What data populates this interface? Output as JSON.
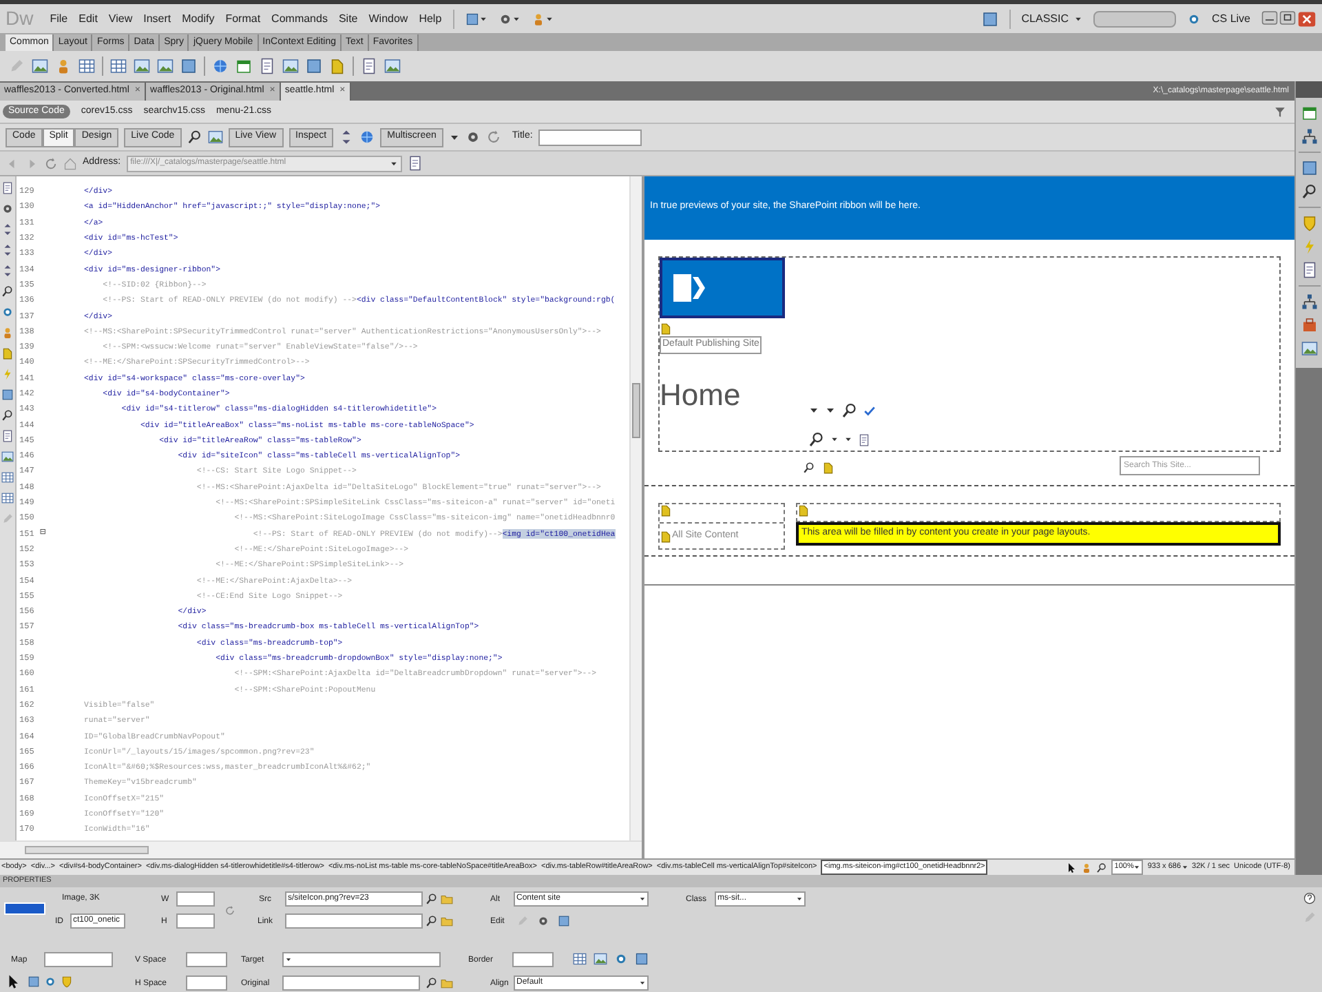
{
  "menu_bar": {
    "logo": "Dw",
    "items": [
      "File",
      "Edit",
      "View",
      "Insert",
      "Modify",
      "Format",
      "Commands",
      "Site",
      "Window",
      "Help"
    ],
    "workspace": "CLASSIC",
    "cs_live": "CS Live"
  },
  "insert_tabs": [
    {
      "label": "Common",
      "selected": true
    },
    {
      "label": "Layout",
      "selected": false
    },
    {
      "label": "Forms",
      "selected": false
    },
    {
      "label": "Data",
      "selected": false
    },
    {
      "label": "Spry",
      "selected": false
    },
    {
      "label": "jQuery Mobile",
      "selected": false
    },
    {
      "label": "InContext Editing",
      "selected": false
    },
    {
      "label": "Text",
      "selected": false
    },
    {
      "label": "Favorites",
      "selected": false
    }
  ],
  "document_tabs": [
    {
      "label": "waffles2013 - Converted.html",
      "close": "×",
      "selected": false
    },
    {
      "label": "waffles2013 - Original.html",
      "close": "×",
      "selected": false
    },
    {
      "label": "seattle.html",
      "close": "×",
      "selected": true
    }
  ],
  "document_path": "X:\\_catalogs\\masterpage\\seattle.html",
  "related_files": [
    {
      "label": "Source Code",
      "selected": true
    },
    {
      "label": "corev15.css",
      "selected": false
    },
    {
      "label": "searchv15.css",
      "selected": false
    },
    {
      "label": "menu-21.css",
      "selected": false
    }
  ],
  "document_toolbar": {
    "views": [
      {
        "label": "Code",
        "selected": false
      },
      {
        "label": "Split",
        "selected": true
      },
      {
        "label": "Design",
        "selected": false
      }
    ],
    "live_code": "Live Code",
    "live_view": "Live View",
    "inspect": "Inspect",
    "multiscreen": "Multiscreen",
    "title_label": "Title:"
  },
  "address_bar": {
    "label": "Address:",
    "value": "file:///X|/_catalogs/masterpage/seattle.html"
  },
  "code_lines": [
    {
      "number": "129",
      "parts": [
        {
          "kind": "tag",
          "text": "</div>"
        }
      ]
    },
    {
      "number": "130",
      "parts": [
        {
          "kind": "tag",
          "text": "<a id=\"HiddenAnchor\" href=\"javascript:;\" style=\"display:none;\">"
        }
      ]
    },
    {
      "number": "131",
      "parts": [
        {
          "kind": "tag",
          "text": "</a>"
        }
      ]
    },
    {
      "number": "132",
      "parts": [
        {
          "kind": "tag",
          "text": "<div id=\"ms-hcTest\">"
        }
      ]
    },
    {
      "number": "133",
      "parts": [
        {
          "kind": "tag",
          "text": "</div>"
        }
      ]
    },
    {
      "number": "134",
      "parts": [
        {
          "kind": "tag",
          "text": "<div id=\"ms-designer-ribbon\">"
        }
      ]
    },
    {
      "number": "135",
      "parts": [
        {
          "kind": "comment",
          "text": "    <!--SID:02 {Ribbon}-->"
        }
      ]
    },
    {
      "number": "136",
      "parts": [
        {
          "kind": "comment",
          "text": "    <!--PS: Start of READ-ONLY PREVIEW (do not modify) -->"
        },
        {
          "kind": "tag",
          "text": "<div class=\"DefaultContentBlock\" style=\"background:rgb("
        }
      ]
    },
    {
      "number": "137",
      "parts": [
        {
          "kind": "tag",
          "text": "</div>"
        }
      ]
    },
    {
      "number": "138",
      "parts": [
        {
          "kind": "comment",
          "text": "<!--MS:<SharePoint:SPSecurityTrimmedControl runat=\"server\" AuthenticationRestrictions=\"AnonymousUsersOnly\">-->"
        }
      ]
    },
    {
      "number": "139",
      "parts": [
        {
          "kind": "comment",
          "text": "    <!--SPM:<wssucw:Welcome runat=\"server\" EnableViewState=\"false\"/>-->"
        }
      ]
    },
    {
      "number": "140",
      "parts": [
        {
          "kind": "comment",
          "text": "<!--ME:</SharePoint:SPSecurityTrimmedControl>-->"
        }
      ]
    },
    {
      "number": "141",
      "parts": [
        {
          "kind": "tag",
          "text": "<div id=\"s4-workspace\" class=\"ms-core-overlay\">"
        }
      ]
    },
    {
      "number": "142",
      "parts": [
        {
          "kind": "tag",
          "text": "    <div id=\"s4-bodyContainer\">"
        }
      ]
    },
    {
      "number": "143",
      "parts": [
        {
          "kind": "tag",
          "text": "        <div id=\"s4-titlerow\" class=\"ms-dialogHidden s4-titlerowhidetitle\">"
        }
      ]
    },
    {
      "number": "144",
      "parts": [
        {
          "kind": "tag",
          "text": "            <div id=\"titleAreaBox\" class=\"ms-noList ms-table ms-core-tableNoSpace\">"
        }
      ]
    },
    {
      "number": "145",
      "parts": [
        {
          "kind": "tag",
          "text": "                <div id=\"titleAreaRow\" class=\"ms-tableRow\">"
        }
      ]
    },
    {
      "number": "146",
      "parts": [
        {
          "kind": "tag",
          "text": "                    <div id=\"siteIcon\" class=\"ms-tableCell ms-verticalAlignTop\">"
        }
      ]
    },
    {
      "number": "147",
      "parts": [
        {
          "kind": "comment",
          "text": "                        <!--CS: Start Site Logo Snippet-->"
        }
      ]
    },
    {
      "number": "148",
      "parts": [
        {
          "kind": "comment",
          "text": "                        <!--MS:<SharePoint:AjaxDelta id=\"DeltaSiteLogo\" BlockElement=\"true\" runat=\"server\">-->"
        }
      ]
    },
    {
      "number": "149",
      "parts": [
        {
          "kind": "comment",
          "text": "                            <!--MS:<SharePoint:SPSimpleSiteLink CssClass=\"ms-siteicon-a\" runat=\"server\" id=\"oneti"
        }
      ]
    },
    {
      "number": "150",
      "parts": [
        {
          "kind": "comment",
          "text": "                                <!--MS:<SharePoint:SiteLogoImage CssClass=\"ms-siteicon-img\" name=\"onetidHeadbnnr0"
        }
      ]
    },
    {
      "number": "151",
      "fold_marker": "⊟",
      "parts": [
        {
          "kind": "comment",
          "text": "                                    <!--PS: Start of READ-ONLY PREVIEW (do not modify)-->"
        },
        {
          "kind": "selection",
          "text": "<img id=\"ct100_onetidHea"
        }
      ]
    },
    {
      "number": "152",
      "parts": [
        {
          "kind": "comment",
          "text": "                                <!--ME:</SharePoint:SiteLogoImage>-->"
        }
      ]
    },
    {
      "number": "153",
      "parts": [
        {
          "kind": "comment",
          "text": "                            <!--ME:</SharePoint:SPSimpleSiteLink>-->"
        }
      ]
    },
    {
      "number": "154",
      "parts": [
        {
          "kind": "comment",
          "text": "                        <!--ME:</SharePoint:AjaxDelta>-->"
        }
      ]
    },
    {
      "number": "155",
      "parts": [
        {
          "kind": "comment",
          "text": "                        <!--CE:End Site Logo Snippet-->"
        }
      ]
    },
    {
      "number": "156",
      "parts": [
        {
          "kind": "tag",
          "text": "                    </div>"
        }
      ]
    },
    {
      "number": "157",
      "parts": [
        {
          "kind": "tag",
          "text": "                    <div class=\"ms-breadcrumb-box ms-tableCell ms-verticalAlignTop\">"
        }
      ]
    },
    {
      "number": "158",
      "parts": [
        {
          "kind": "tag",
          "text": "                        <div class=\"ms-breadcrumb-top\">"
        }
      ]
    },
    {
      "number": "159",
      "parts": [
        {
          "kind": "tag",
          "text": "                            <div class=\"ms-breadcrumb-dropdownBox\" style=\"display:none;\">"
        }
      ]
    },
    {
      "number": "160",
      "parts": [
        {
          "kind": "comment",
          "text": "                                <!--SPM:<SharePoint:AjaxDelta id=\"DeltaBreadcrumbDropdown\" runat=\"server\">-->"
        }
      ]
    },
    {
      "number": "161",
      "parts": [
        {
          "kind": "comment",
          "text": "                                <!--SPM:<SharePoint:PopoutMenu"
        }
      ]
    },
    {
      "number": "162",
      "parts": [
        {
          "kind": "comment",
          "text": "Visible=\"false\""
        }
      ]
    },
    {
      "number": "163",
      "parts": [
        {
          "kind": "comment",
          "text": "runat=\"server\""
        }
      ]
    },
    {
      "number": "164",
      "parts": [
        {
          "kind": "comment",
          "text": "ID=\"GlobalBreadCrumbNavPopout\""
        }
      ]
    },
    {
      "number": "165",
      "parts": [
        {
          "kind": "comment",
          "text": "IconUrl=\"/_layouts/15/images/spcommon.png?rev=23\""
        }
      ]
    },
    {
      "number": "166",
      "parts": [
        {
          "kind": "comment",
          "text": "IconAlt=\"&#60;%$Resources:wss,master_breadcrumbIconAlt%&#62;\""
        }
      ]
    },
    {
      "number": "167",
      "parts": [
        {
          "kind": "comment",
          "text": "ThemeKey=\"v15breadcrumb\""
        }
      ]
    },
    {
      "number": "168",
      "parts": [
        {
          "kind": "comment",
          "text": "IconOffsetX=\"215\""
        }
      ]
    },
    {
      "number": "169",
      "parts": [
        {
          "kind": "comment",
          "text": "IconOffsetY=\"120\""
        }
      ]
    },
    {
      "number": "170",
      "parts": [
        {
          "kind": "comment",
          "text": "IconWidth=\"16\""
        }
      ]
    }
  ],
  "design_view": {
    "ribbon_notice": "In true previews of your site, the SharePoint ribbon will be here.",
    "site_title": "Default Publishing Site",
    "page_title": "Home",
    "search_placeholder": "Search This Site...",
    "nav_link": "All Site Content",
    "content_notice": "This area will be filled in by content you create in your page layouts."
  },
  "tag_selector": [
    {
      "label": "<body>",
      "selected": false
    },
    {
      "label": "<div...>",
      "selected": false
    },
    {
      "label": "<div#s4-bodyContainer>",
      "selected": false
    },
    {
      "label": "<div.ms-dialogHidden s4-titlerowhidetitle#s4-titlerow>",
      "selected": false
    },
    {
      "label": "<div.ms-noList ms-table ms-core-tableNoSpace#titleAreaBox>",
      "selected": false
    },
    {
      "label": "<div.ms-tableRow#titleAreaRow>",
      "selected": false
    },
    {
      "label": "<div.ms-tableCell ms-verticalAlignTop#siteIcon>",
      "selected": false
    },
    {
      "label": "<img.ms-siteicon-img#ct100_onetidHeadbnnr2>",
      "selected": true
    }
  ],
  "status": {
    "zoom": "100%",
    "dimensions": "933 x 686",
    "download": "32K / 1 sec",
    "encoding": "Unicode (UTF-8)"
  },
  "properties": {
    "title": "PROPERTIES",
    "element": "Image, 3K",
    "w_label": "W",
    "h_label": "H",
    "id_label": "ID",
    "id_value": "ct100_onetic",
    "src_label": "Src",
    "src_value": "s/siteIcon.png?rev=23",
    "link_label": "Link",
    "alt_label": "Alt",
    "alt_value": "Content site",
    "edit_label": "Edit",
    "class_label": "Class",
    "class_value": "ms-sit...",
    "map_label": "Map",
    "vspace_label": "V Space",
    "target_label": "Target",
    "border_label": "Border",
    "hspace_label": "H Space",
    "original_label": "Original",
    "align_label": "Align",
    "align_value": "Default"
  }
}
